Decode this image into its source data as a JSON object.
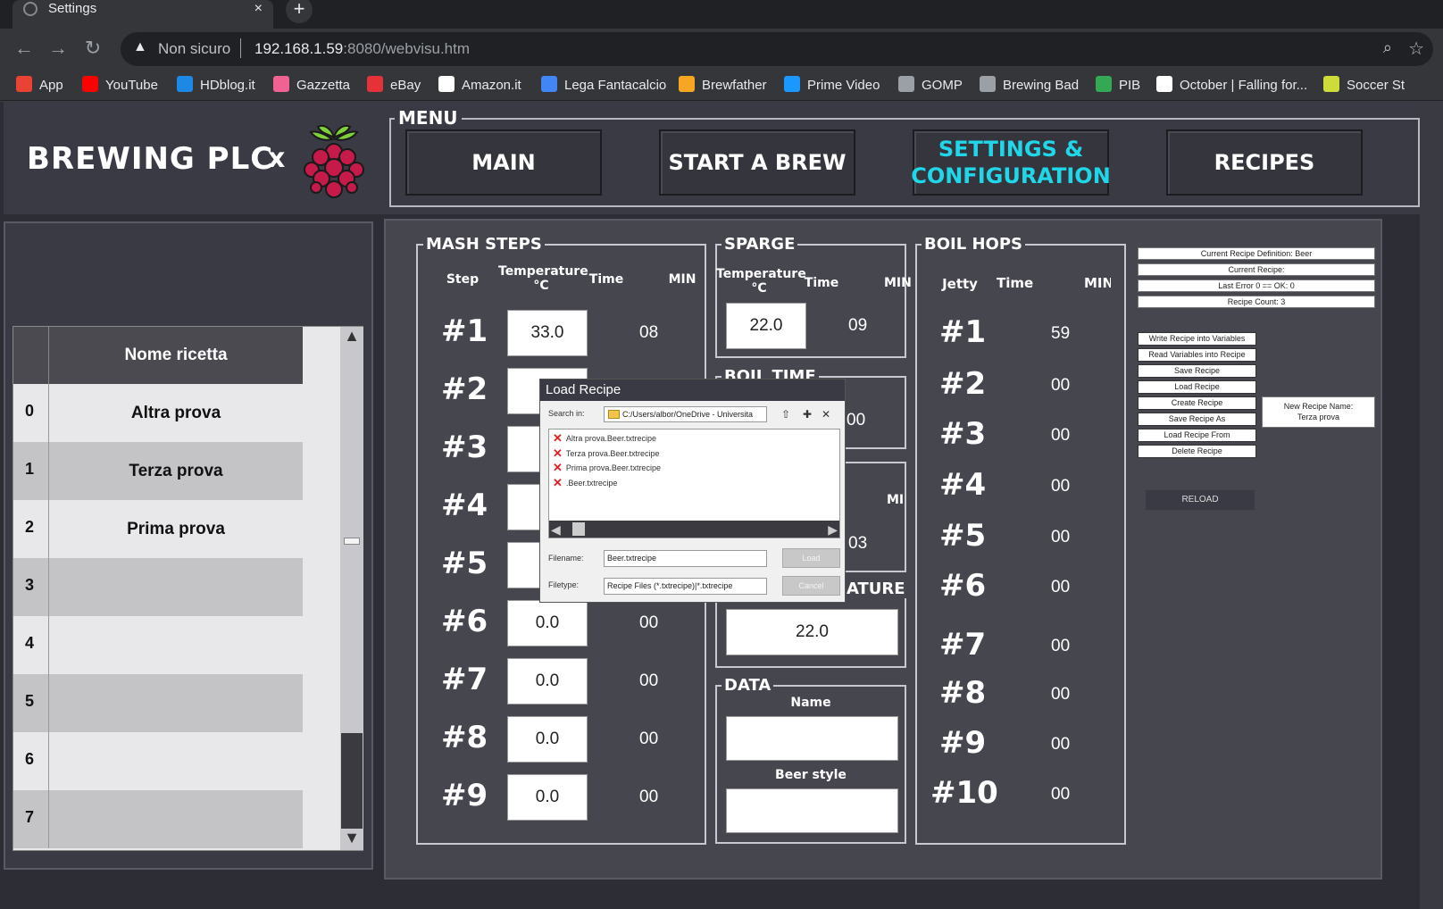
{
  "browser": {
    "tab_title": "Settings",
    "tab_close": "×",
    "new_tab": "+",
    "security_label": "Non sicuro",
    "url_host": "192.168.1.59",
    "url_rest": ":8080/webvisu.htm",
    "bookmarks": [
      {
        "label": "App",
        "icon": "apps-grid-icon",
        "color": "#ea4335"
      },
      {
        "label": "YouTube",
        "icon": "youtube-icon",
        "color": "#ff0000"
      },
      {
        "label": "HDblog.it",
        "icon": "hdblog-icon",
        "color": "#1e88e5"
      },
      {
        "label": "Gazzetta",
        "icon": "gazzetta-icon",
        "color": "#f06292"
      },
      {
        "label": "eBay",
        "icon": "ebay-icon",
        "color": "#e53238"
      },
      {
        "label": "Amazon.it",
        "icon": "amazon-icon",
        "color": "#ffffff"
      },
      {
        "label": "Lega Fantacalcio",
        "icon": "google-icon",
        "color": "#4285f4"
      },
      {
        "label": "Brewfather",
        "icon": "brewfather-icon",
        "color": "#f5a623"
      },
      {
        "label": "Prime Video",
        "icon": "prime-video-icon",
        "color": "#1a98ff"
      },
      {
        "label": "GOMP",
        "icon": "globe-icon",
        "color": "#9aa0a6"
      },
      {
        "label": "Brewing Bad",
        "icon": "globe-icon",
        "color": "#9aa0a6"
      },
      {
        "label": "PIB",
        "icon": "clover-icon",
        "color": "#34a853"
      },
      {
        "label": "October | Falling for...",
        "icon": "arch-icon",
        "color": "#ffffff"
      },
      {
        "label": "Soccer St",
        "icon": "soccer-ball-icon",
        "color": "#cddc39"
      }
    ]
  },
  "header": {
    "brand": "BREWING PLC",
    "brand_x": "x",
    "menu_title": "MENU",
    "menu": [
      {
        "label": "MAIN",
        "active": false
      },
      {
        "label": "START A BREW",
        "active": false
      },
      {
        "label": "SETTINGS & CONFIGURATION",
        "active": true
      },
      {
        "label": "RECIPES",
        "active": false
      }
    ],
    "active_color": "#1fd7e8"
  },
  "recipes_table": {
    "header": "Nome ricetta",
    "rows": [
      {
        "index": "0",
        "name": "Altra prova"
      },
      {
        "index": "1",
        "name": "Terza prova"
      },
      {
        "index": "2",
        "name": "Prima prova"
      },
      {
        "index": "3",
        "name": ""
      },
      {
        "index": "4",
        "name": ""
      },
      {
        "index": "5",
        "name": ""
      },
      {
        "index": "6",
        "name": ""
      },
      {
        "index": "7",
        "name": ""
      }
    ]
  },
  "mash": {
    "title": "MASH STEPS",
    "col_step": "Step",
    "col_temp": "Temperature °C",
    "col_time": "Time",
    "col_min": "MIN",
    "steps": [
      {
        "n": "#1",
        "temp": "33.0",
        "time": "08"
      },
      {
        "n": "#2",
        "temp": "",
        "time": ""
      },
      {
        "n": "#3",
        "temp": "",
        "time": ""
      },
      {
        "n": "#4",
        "temp": "",
        "time": ""
      },
      {
        "n": "#5",
        "temp": "",
        "time": ""
      },
      {
        "n": "#6",
        "temp": "0.0",
        "time": "00"
      },
      {
        "n": "#7",
        "temp": "0.0",
        "time": "00"
      },
      {
        "n": "#8",
        "temp": "0.0",
        "time": "00"
      },
      {
        "n": "#9",
        "temp": "0.0",
        "time": "00"
      }
    ]
  },
  "sparge": {
    "title": "SPARGE",
    "col_temp": "Temperature °C",
    "col_time": "Time",
    "col_min": "MIN",
    "temp": "22.0",
    "time": "09"
  },
  "boil_time": {
    "title": "BOIL TIME",
    "value_partial": "00"
  },
  "hidden_group": {
    "col_min_partial": "MI",
    "value": "03"
  },
  "temperature_group": {
    "title_partial": "ATURE",
    "value": "22.0"
  },
  "data_group": {
    "title": "DATA",
    "name_label": "Name",
    "name_value": "",
    "style_label": "Beer style",
    "style_value": ""
  },
  "boil_hops": {
    "title": "BOIL HOPS",
    "col_jetty": "Jetty",
    "col_time": "Time",
    "col_min": "MIN",
    "rows": [
      {
        "n": "#1",
        "time": "59"
      },
      {
        "n": "#2",
        "time": "00"
      },
      {
        "n": "#3",
        "time": "00"
      },
      {
        "n": "#4",
        "time": "00"
      },
      {
        "n": "#5",
        "time": "00"
      },
      {
        "n": "#6",
        "time": "00"
      },
      {
        "n": "#7",
        "time": "00"
      },
      {
        "n": "#8",
        "time": "00"
      },
      {
        "n": "#9",
        "time": "00"
      },
      {
        "n": "#10",
        "time": "00"
      }
    ]
  },
  "info": {
    "current_def": "Current Recipe Definition: Beer",
    "current_recipe": "Current Recipe:",
    "last_error": "Last Error 0 == OK: 0",
    "recipe_count": "Recipe Count: 3",
    "new_recipe_name_label": "New Recipe Name:",
    "new_recipe_name_value": "Terza prova"
  },
  "actions": [
    "Write Recipe into Variables",
    "Read Variables into Recipe",
    "Save Recipe",
    "Load Recipe",
    "Create Recipe",
    "Save Recipe As",
    "Load Recipe From",
    "Delete Recipe"
  ],
  "reload_label": "RELOAD",
  "dialog": {
    "title": "Load Recipe",
    "search_in_label": "Search in:",
    "search_in_value": "C:/Users/albor/OneDrive - Universita",
    "files": [
      "Altra prova.Beer.txtrecipe",
      "Terza prova.Beer.txtrecipe",
      "Prima prova.Beer.txtrecipe",
      ".Beer.txtrecipe"
    ],
    "filename_label": "Filename:",
    "filename_value": "Beer.txtrecipe",
    "filetype_label": "Filetype:",
    "filetype_value": "Recipe Files (*.txtrecipe)|*.txtrecipe",
    "load_label": "Load",
    "cancel_label": "Cancel"
  }
}
